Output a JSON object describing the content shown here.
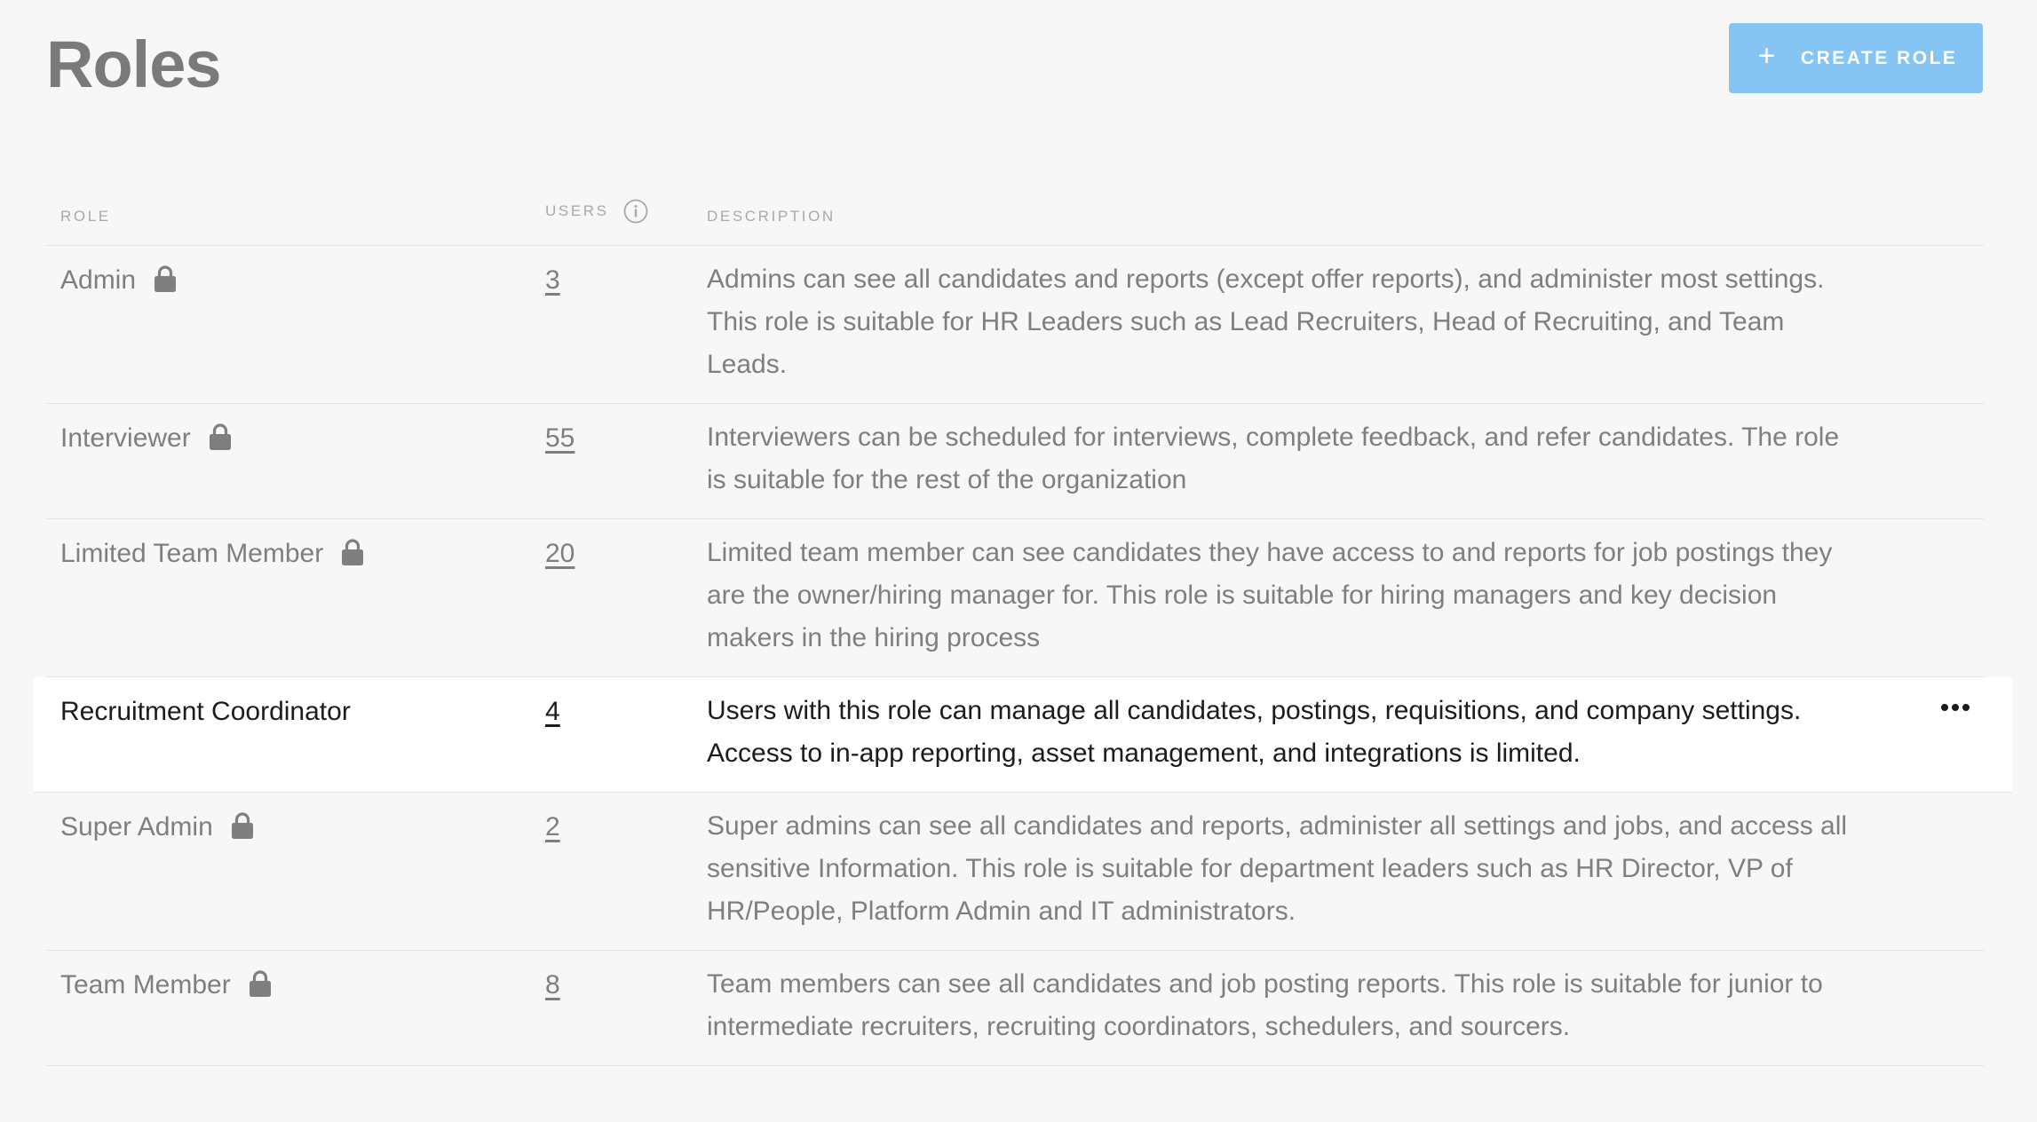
{
  "header": {
    "title": "Roles",
    "create_button_label": "CREATE ROLE",
    "create_button_icon": "plus-icon"
  },
  "table": {
    "columns": {
      "role": "ROLE",
      "users": "USERS",
      "description": "DESCRIPTION"
    },
    "rows": [
      {
        "name": "Admin",
        "locked": true,
        "users": "3",
        "description": "Admins can see all candidates and reports (except offer reports), and administer most settings. This role is suitable for HR Leaders such as Lead Recruiters, Head of Recruiting, and Team Leads."
      },
      {
        "name": "Interviewer",
        "locked": true,
        "users": "55",
        "description": "Interviewers can be scheduled for interviews, complete feedback, and refer candidates. The role is suitable for the rest of the organization"
      },
      {
        "name": "Limited Team Member",
        "locked": true,
        "users": "20",
        "description": "Limited team member can see candidates they have access to and reports for job postings they are the owner/hiring manager for. This role is suitable for hiring managers and key decision makers in the hiring process"
      },
      {
        "name": "Recruitment Coordinator",
        "locked": false,
        "users": "4",
        "description": "Users with this role can manage all candidates, postings, requisitions, and company settings. Access to in-app reporting, asset management, and integrations is limited.",
        "highlighted": true
      },
      {
        "name": "Super Admin",
        "locked": true,
        "users": "2",
        "description": "Super admins can see all candidates and reports, administer all settings and jobs, and access all sensitive Information. This role is suitable for department leaders such as HR Director, VP of HR/People, Platform Admin and IT administrators."
      },
      {
        "name": "Team Member",
        "locked": true,
        "users": "8",
        "description": "Team members can see all candidates and job posting reports. This role is suitable for junior to intermediate recruiters, recruiting coordinators, schedulers, and sourcers."
      }
    ]
  },
  "colors": {
    "background": "#f7f7f7",
    "button": "#86c5f3",
    "muted_text": "#7f7f7f",
    "active_text": "#1c1c1c"
  }
}
